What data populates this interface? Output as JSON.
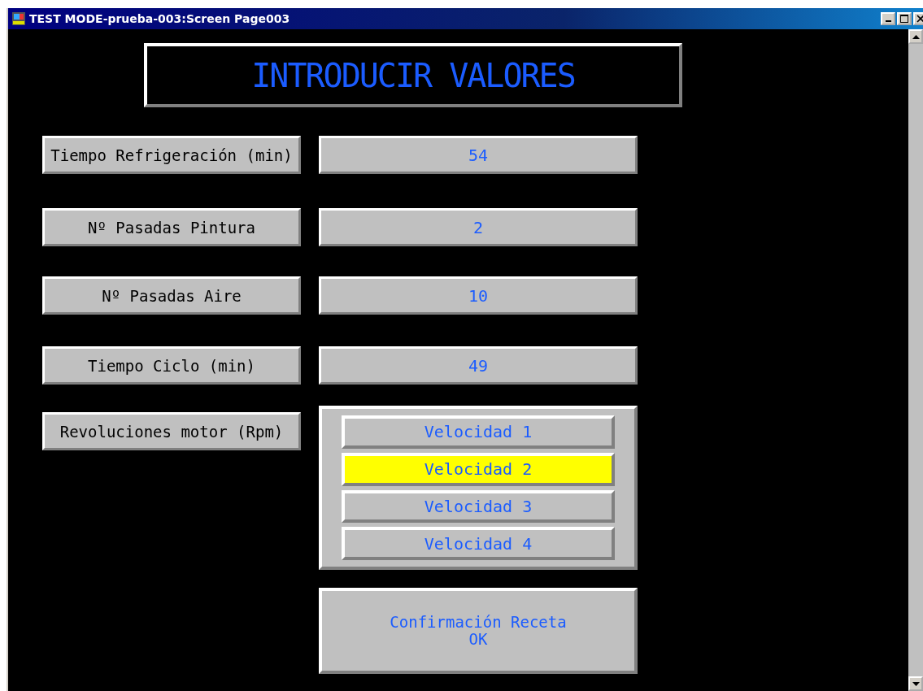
{
  "window": {
    "title": "TEST MODE-prueba-003:Screen Page003"
  },
  "heading": "INTRODUCIR VALORES",
  "fields": [
    {
      "label": "Tiempo Refrigeración (min)",
      "value": "54"
    },
    {
      "label": "Nº Pasadas Pintura",
      "value": "2"
    },
    {
      "label": "Nº Pasadas Aire",
      "value": "10"
    },
    {
      "label": "Tiempo Ciclo (min)",
      "value": "49"
    }
  ],
  "speed": {
    "label": "Revoluciones motor (Rpm)",
    "options": [
      {
        "label": "Velocidad 1",
        "selected": false
      },
      {
        "label": "Velocidad 2",
        "selected": true
      },
      {
        "label": "Velocidad 3",
        "selected": false
      },
      {
        "label": "Velocidad 4",
        "selected": false
      }
    ]
  },
  "confirm_button": {
    "lines": [
      "Confirmación Receta",
      "OK"
    ]
  }
}
